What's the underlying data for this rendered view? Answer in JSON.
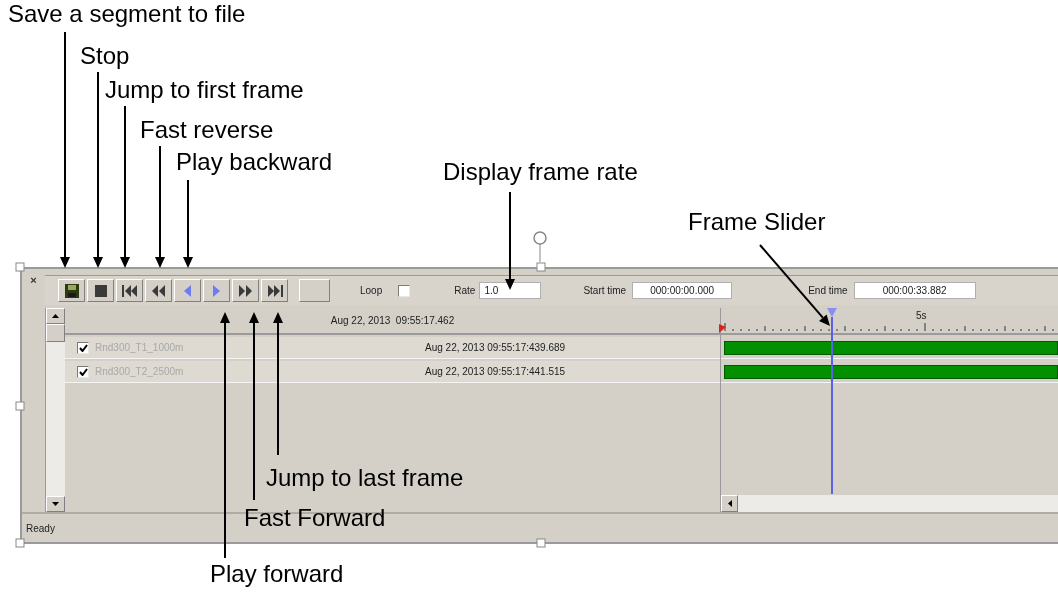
{
  "callouts": [
    {
      "text": "Save a segment to file"
    },
    {
      "text": "Stop"
    },
    {
      "text": "Jump to first frame"
    },
    {
      "text": "Fast reverse"
    },
    {
      "text": "Play backward"
    },
    {
      "text": "Display frame rate"
    },
    {
      "text": "Frame Slider"
    },
    {
      "text": "Jump to last frame"
    },
    {
      "text": "Fast Forward"
    },
    {
      "text": "Play forward"
    }
  ],
  "close": "×",
  "toolbar": {
    "buttons": [
      {
        "kind": "save"
      },
      {
        "kind": "stop"
      },
      {
        "kind": "first"
      },
      {
        "kind": "fast_reverse"
      },
      {
        "kind": "play_backward"
      },
      {
        "kind": "play_forward"
      },
      {
        "kind": "fast_forward"
      },
      {
        "kind": "last"
      },
      {
        "kind": "blank"
      }
    ],
    "loop": {
      "label": "Loop",
      "checked": false
    },
    "rate": {
      "label": "Rate",
      "value": "1.0"
    },
    "start_time": {
      "label": "Start time",
      "value": "000:00:00.000"
    },
    "end_time": {
      "label": "End time",
      "value": "000:00:33.882"
    }
  },
  "header_time": "Aug 22, 2013  09:55:17.462",
  "ruler_label": "5s",
  "frame_slider": {
    "level": 0.33
  },
  "tracks": [
    {
      "name": "Rnd300_T1_1000m",
      "checked": true,
      "time": "Aug 22, 2013 09:55:17:439.689"
    },
    {
      "name": "Rnd300_T2_2500m",
      "checked": true,
      "time": "Aug 22, 2013 09:55:17:441.515"
    }
  ],
  "status_bar": "Ready"
}
